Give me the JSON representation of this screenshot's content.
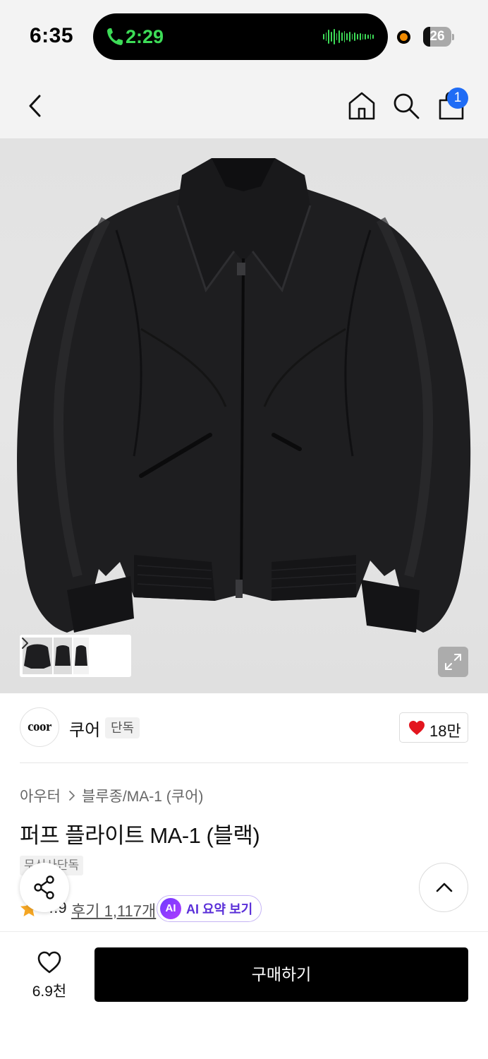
{
  "status_bar": {
    "time": "6:35",
    "call_timer": "2:29",
    "battery_level": "26",
    "battery_fraction": 0.26
  },
  "nav": {
    "back_icon": "chevron-left-icon",
    "home_icon": "home-icon",
    "search_icon": "search-icon",
    "cart_icon": "shopping-bag-icon",
    "cart_badge": "1"
  },
  "gallery": {
    "image_subject": "black puffer flight jacket",
    "thumbnail_count": 3,
    "expand_icon": "expand-icon"
  },
  "brand": {
    "logo_text": "coor",
    "name": "쿠어",
    "tag": "단독",
    "like_count": "18만"
  },
  "product": {
    "breadcrumb": [
      "아우터",
      "블루종/MA-1 (쿠어)"
    ],
    "title": "퍼프 플라이트 MA-1 (블랙)",
    "exclusive_tag": "무신사단독",
    "rating": "4.9",
    "review_link": "후기 1,117개",
    "ai_badge": "AI",
    "ai_summary_label": "AI 요약 보기"
  },
  "floating": {
    "share_icon": "share-icon",
    "scroll_top_icon": "chevron-up-icon"
  },
  "bottom_bar": {
    "wish_count": "6.9천",
    "buy_label": "구매하기"
  },
  "colors": {
    "accent_blue": "#1f6cf5",
    "call_green": "#3ddc57",
    "heart_red": "#e3151e",
    "star_orange": "#f5a623",
    "ai_purple": "#6f3bff",
    "buy_black": "#000000"
  }
}
